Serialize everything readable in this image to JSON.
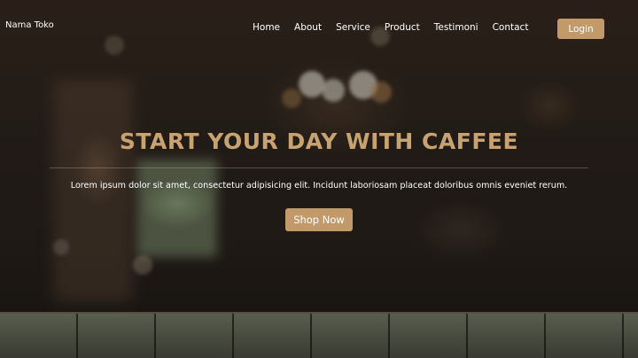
{
  "navbar": {
    "brand": "Nama Toko",
    "links": [
      "Home",
      "About",
      "Service",
      "Product",
      "Testimoni",
      "Contact"
    ],
    "login_label": "Login"
  },
  "hero": {
    "headline": "START YOUR DAY WITH CAFFEE",
    "subtext": "Lorem ipsum dolor sit amet, consectetur adipisicing elit. Incidunt laboriosam placeat doloribus omnis eveniet rerum.",
    "cta_label": "Shop Now"
  },
  "colors": {
    "accent": "#c29a6a",
    "headline": "#c9a272",
    "text": "#ffffff"
  }
}
